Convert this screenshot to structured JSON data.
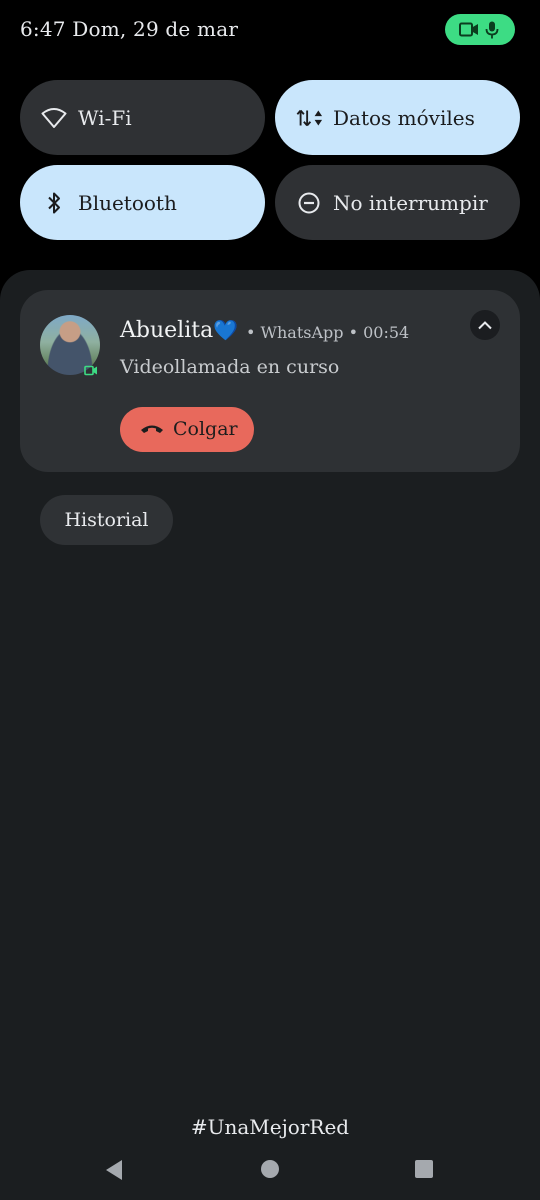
{
  "status_bar": {
    "time_date": "6:47 Dom, 29 de mar",
    "privacy_chip": {
      "icons": [
        "video-camera-icon",
        "microphone-icon"
      ],
      "color": "#3ddc84"
    }
  },
  "quick_settings": [
    {
      "label": "Wi-Fi",
      "icon": "wifi-icon",
      "active": false
    },
    {
      "label": "Datos móviles",
      "icon": "mobile-data-icon",
      "active": true
    },
    {
      "label": "Bluetooth",
      "icon": "bluetooth-icon",
      "active": true
    },
    {
      "label": "No interrumpir",
      "icon": "do-not-disturb-icon",
      "active": false
    }
  ],
  "notification": {
    "title": "Abuelita",
    "title_emoji": "💙",
    "meta": "• WhatsApp • 00:54",
    "text": "Videollamada en curso",
    "action_label": "Colgar",
    "action_color": "#e8695c"
  },
  "history_label": "Historial",
  "carrier_text": "#UnaMejorRed",
  "colors": {
    "active_tile": "#c9e6fc",
    "inactive_tile": "#2f3134",
    "shade": "#1b1e20"
  }
}
